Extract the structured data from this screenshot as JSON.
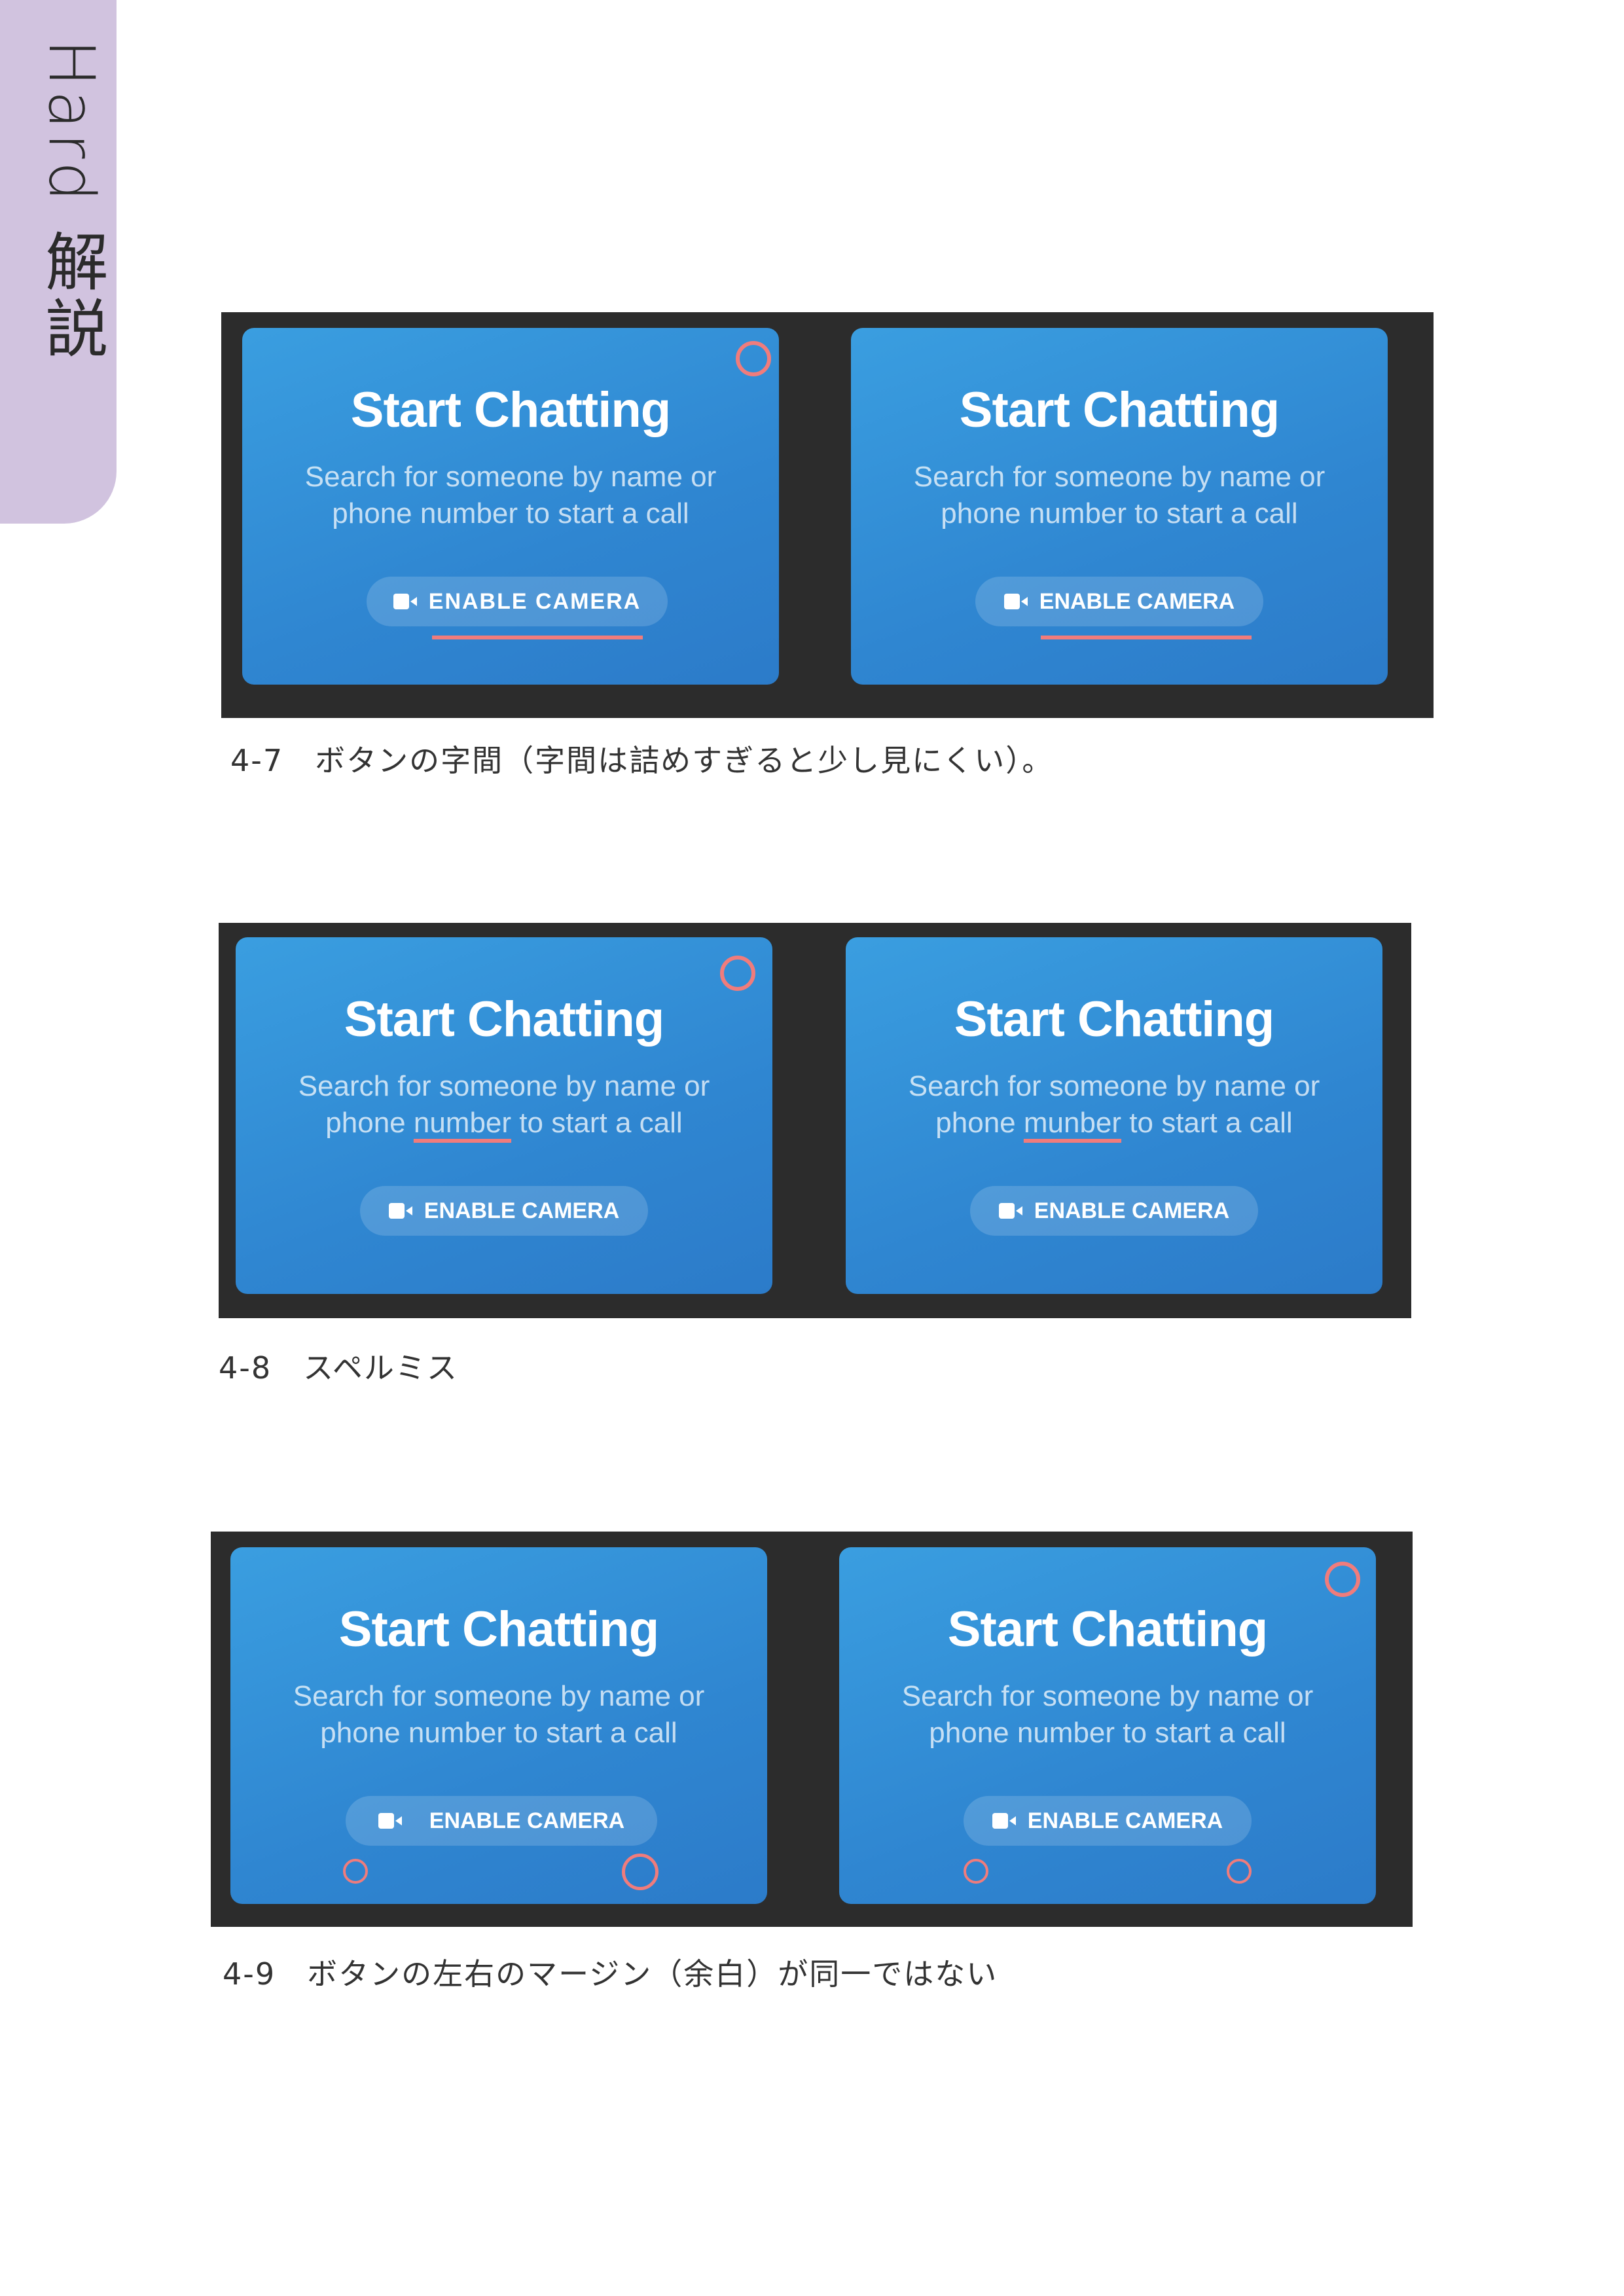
{
  "side_tab": {
    "label": "Hard 解説"
  },
  "card": {
    "title": "Start Chatting",
    "subtitle_line1": "Search for someone by name or",
    "subtitle_line2_prefix": "phone ",
    "subtitle_word_correct": "number",
    "subtitle_word_misspelled": "munber",
    "subtitle_line2_suffix": " to start a call",
    "subtitle_line2": "phone number to start a call",
    "button_label": "ENABLE CAMERA",
    "button_icon": "video-camera-icon"
  },
  "figures": [
    {
      "id": "4-7",
      "caption": "4-7　ボタンの字間（字間は詰めすぎると少し見にくい）。"
    },
    {
      "id": "4-8",
      "caption": "4-8　スペルミス"
    },
    {
      "id": "4-9",
      "caption": "4-9　ボタンの左右のマージン（余白）が同一ではない"
    }
  ],
  "colors": {
    "side_tab": "#d1c3df",
    "figure_bg": "#2c2c2c",
    "card_blue": "#2f86d1",
    "marker": "#f07c7c"
  }
}
